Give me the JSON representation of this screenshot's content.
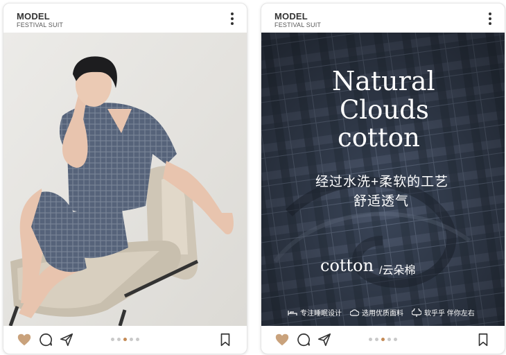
{
  "cards": [
    {
      "title": "MODEL",
      "subtitle": "FESTIVAL SUIT",
      "carousel": {
        "count": 5,
        "active": 3
      }
    },
    {
      "title": "MODEL",
      "subtitle": "FESTIVAL SUIT",
      "carousel": {
        "count": 5,
        "active": 3
      },
      "overlay": {
        "line1": "Natural",
        "line2": "Clouds",
        "line3": "cotton",
        "cn_line1": "经过水洗+柔软的工艺",
        "cn_line2": "舒适透气",
        "cotton_label": "cotton",
        "cotton_cn": "/云朵棉",
        "features": [
          "专注睡眠设计",
          "选用优质面料",
          "软乎乎 伴你左右"
        ]
      }
    }
  ],
  "icons": {
    "more": "more-vertical-icon",
    "like": "heart-icon",
    "comment": "comment-icon",
    "share": "send-icon",
    "save": "bookmark-icon"
  },
  "colors": {
    "heart": "#c9a27c",
    "dot_active": "#c48a55",
    "fabric": "#3a4558"
  }
}
